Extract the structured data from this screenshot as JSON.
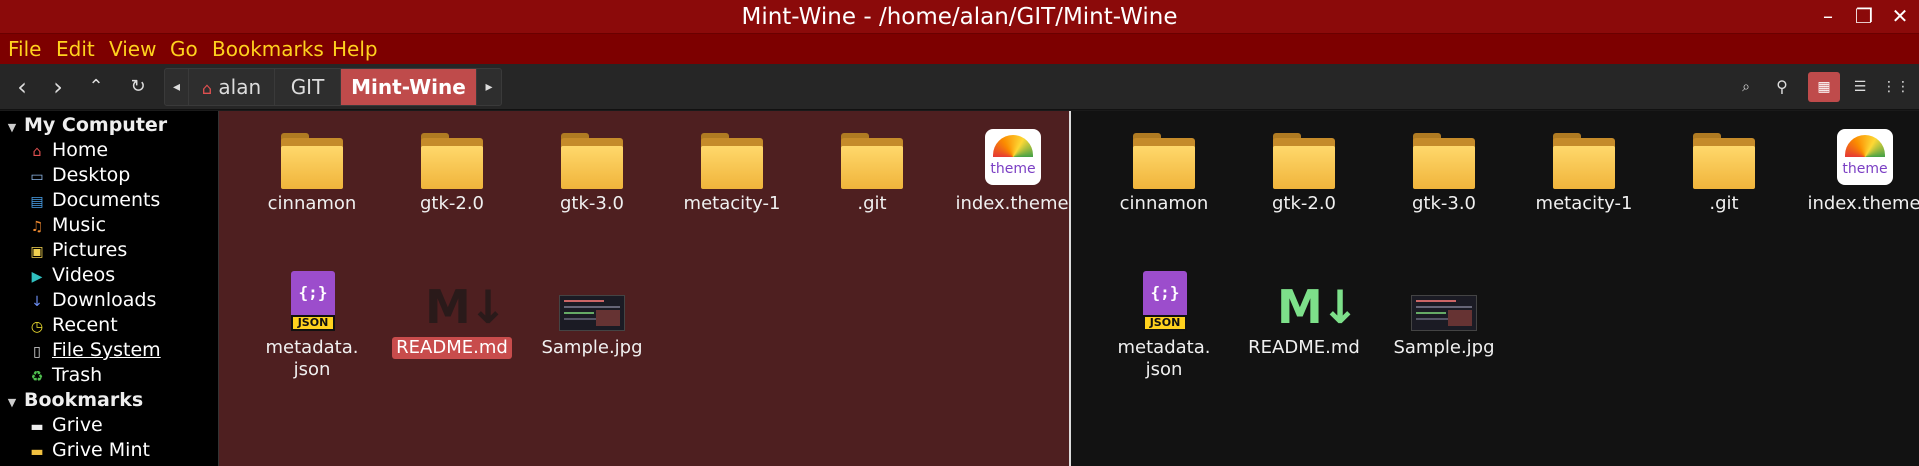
{
  "window": {
    "title": "Mint-Wine - /home/alan/GIT/Mint-Wine",
    "controls": {
      "minimize": "–",
      "maximize": "❐",
      "close": "✕"
    }
  },
  "menubar": [
    "File",
    "Edit",
    "View",
    "Go",
    "Bookmarks",
    "Help"
  ],
  "toolbar": {
    "back": "‹",
    "forward": "›",
    "up": "⌃",
    "reload": "↻",
    "crumb_prev": "◂",
    "crumb_next": "▸",
    "breadcrumb": [
      "alan",
      "GIT",
      "Mint-Wine"
    ],
    "active_crumb": "Mint-Wine",
    "right_icons": [
      "toggle-location-icon",
      "search-icon",
      "icon-view-icon",
      "list-view-icon",
      "compact-view-icon"
    ]
  },
  "sidebar": {
    "sections": [
      {
        "title": "My Computer",
        "items": [
          {
            "label": "Home",
            "icon": "home-icon",
            "glyph": "⌂",
            "color": "#e05050"
          },
          {
            "label": "Desktop",
            "icon": "desktop-icon",
            "glyph": "▭",
            "color": "#8fb8e8"
          },
          {
            "label": "Documents",
            "icon": "documents-icon",
            "glyph": "▤",
            "color": "#4aa0e8"
          },
          {
            "label": "Music",
            "icon": "music-icon",
            "glyph": "♫",
            "color": "#f08a30"
          },
          {
            "label": "Pictures",
            "icon": "pictures-icon",
            "glyph": "▣",
            "color": "#f0d050"
          },
          {
            "label": "Videos",
            "icon": "videos-icon",
            "glyph": "▶",
            "color": "#30c0c0"
          },
          {
            "label": "Downloads",
            "icon": "downloads-icon",
            "glyph": "↓",
            "color": "#6a8cf0"
          },
          {
            "label": "Recent",
            "icon": "recent-icon",
            "glyph": "◷",
            "color": "#f0e030"
          },
          {
            "label": "File System",
            "icon": "file-system-icon",
            "glyph": "▯",
            "color": "#dddddd"
          },
          {
            "label": "Trash",
            "icon": "trash-icon",
            "glyph": "♻",
            "color": "#50c050"
          }
        ]
      },
      {
        "title": "Bookmarks",
        "items": [
          {
            "label": "Grive",
            "icon": "folder-icon",
            "glyph": "▬",
            "color": "#eeeeee"
          },
          {
            "label": "Grive Mint",
            "icon": "folder-icon",
            "glyph": "▬",
            "color": "#f0c040"
          }
        ]
      }
    ]
  },
  "panes": [
    {
      "name": "left",
      "files": [
        {
          "label": "cinnamon",
          "type": "folder"
        },
        {
          "label": "gtk-2.0",
          "type": "folder"
        },
        {
          "label": "gtk-3.0",
          "type": "folder"
        },
        {
          "label": "metacity-1",
          "type": "folder"
        },
        {
          "label": ".git",
          "type": "folder"
        },
        {
          "label": "index.theme",
          "type": "theme"
        },
        {
          "label": "metadata.\njson",
          "type": "json"
        },
        {
          "label": "README.md",
          "type": "markdown",
          "selected": true
        },
        {
          "label": "Sample.jpg",
          "type": "image"
        }
      ]
    },
    {
      "name": "right",
      "files": [
        {
          "label": "cinnamon",
          "type": "folder"
        },
        {
          "label": "gtk-2.0",
          "type": "folder"
        },
        {
          "label": "gtk-3.0",
          "type": "folder"
        },
        {
          "label": "metacity-1",
          "type": "folder"
        },
        {
          "label": ".git",
          "type": "folder"
        },
        {
          "label": "index.theme",
          "type": "theme"
        },
        {
          "label": "metadata.\njson",
          "type": "json"
        },
        {
          "label": "README.md",
          "type": "markdown"
        },
        {
          "label": "Sample.jpg",
          "type": "image"
        }
      ]
    }
  ],
  "icon_text": {
    "theme": "theme",
    "json_tag": "JSON",
    "json_braces": "{;}",
    "markdown": "M↓"
  },
  "colors": {
    "titlebar": "#8b0a0a",
    "menubar": "#7d0000",
    "menu_text": "#ffd21e",
    "accent": "#bf4b4b",
    "left_pane_bg": "#4e1f20",
    "right_pane_bg": "#121212",
    "md_left": "#2a1a1a",
    "md_right": "#7de08a"
  }
}
